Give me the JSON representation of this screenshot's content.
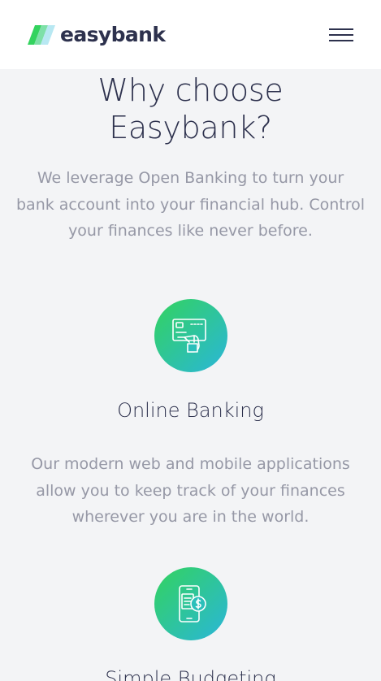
{
  "header": {
    "logo_text": "easybank",
    "menu_icon": "hamburger-menu-icon"
  },
  "why": {
    "title_line1": "Why choose",
    "title_line2": "Easybank?",
    "subtitle": "We leverage Open Banking to turn your bank account into your financial hub. Control your finances like never before."
  },
  "features": [
    {
      "icon": "online-banking-icon",
      "title": "Online Banking",
      "text": "Our modern web and mobile applications allow you to keep track of your finances wherever you are in the world."
    },
    {
      "icon": "budgeting-icon",
      "title": "Simple Budgeting"
    }
  ],
  "colors": {
    "dark_blue": "#2d314d",
    "grayish_blue": "#9698a6",
    "lime_green": "#31d35c",
    "bright_cyan": "#2bb7da",
    "background": "#f3f4f6"
  }
}
